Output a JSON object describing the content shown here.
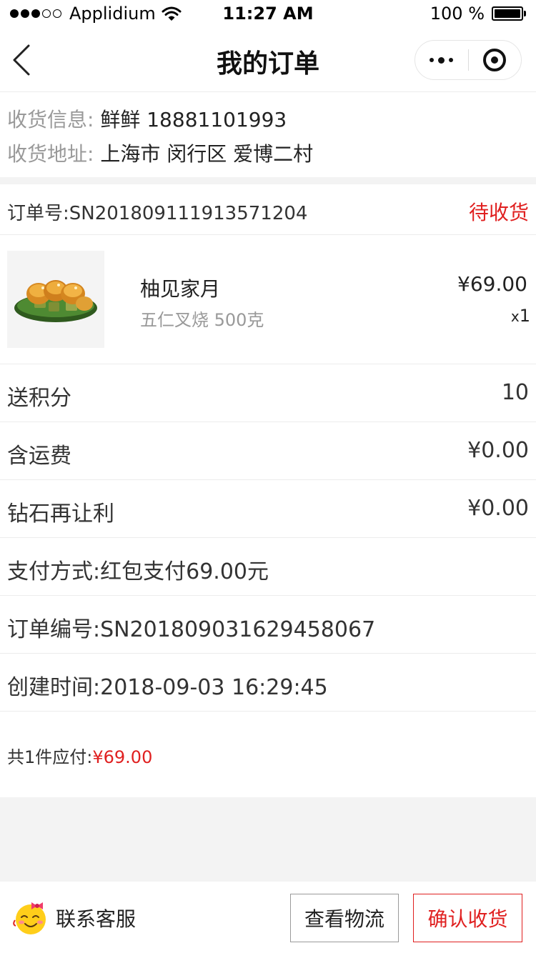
{
  "status_bar": {
    "carrier": "Applidium",
    "time": "11:27 AM",
    "battery": "100 %",
    "battery_level": 1.0
  },
  "nav": {
    "title": "我的订单"
  },
  "shipping": {
    "info_label": "收货信息:",
    "info_value": "鲜鲜 18881101993",
    "address_label": "收货地址:",
    "address_value": "上海市 闵行区 爱博二村"
  },
  "order": {
    "number": "订单号:SN20180911191357120​4",
    "status": "待收货"
  },
  "product": {
    "name": "柚见家月",
    "spec": "五仁叉烧 500克",
    "price": "¥69.00",
    "qty_prefix": "x",
    "qty": "1"
  },
  "details": [
    {
      "label": "送积分",
      "value": "10"
    },
    {
      "label": "含运费",
      "value": "¥0.00"
    },
    {
      "label": "钻石再让利",
      "value": "¥0.00"
    },
    {
      "label": "支付方式:红包支付69.00元",
      "value": ""
    },
    {
      "label": "订单编号:SN20180903162945806​7",
      "value": ""
    },
    {
      "label": "创建时间:2018-09-03 16:29:45",
      "value": ""
    }
  ],
  "total": {
    "prefix": "共1件应付:",
    "amount": "¥69.00"
  },
  "bottom": {
    "service_label": "联系客服",
    "logistics_label": "查看物流",
    "confirm_label": "确认收货"
  },
  "colors": {
    "accent_red": "#e02020",
    "label_gray": "#999999",
    "text_dark": "#333333",
    "divider": "#ececec",
    "band": "#f3f3f3"
  },
  "icons": {
    "back": "chevron-left-icon",
    "more": "more-dots-icon",
    "close": "target-icon",
    "wifi": "wifi-icon",
    "battery": "battery-icon",
    "service": "smiley-bow-icon",
    "product": "mooncake-thumbnail"
  }
}
